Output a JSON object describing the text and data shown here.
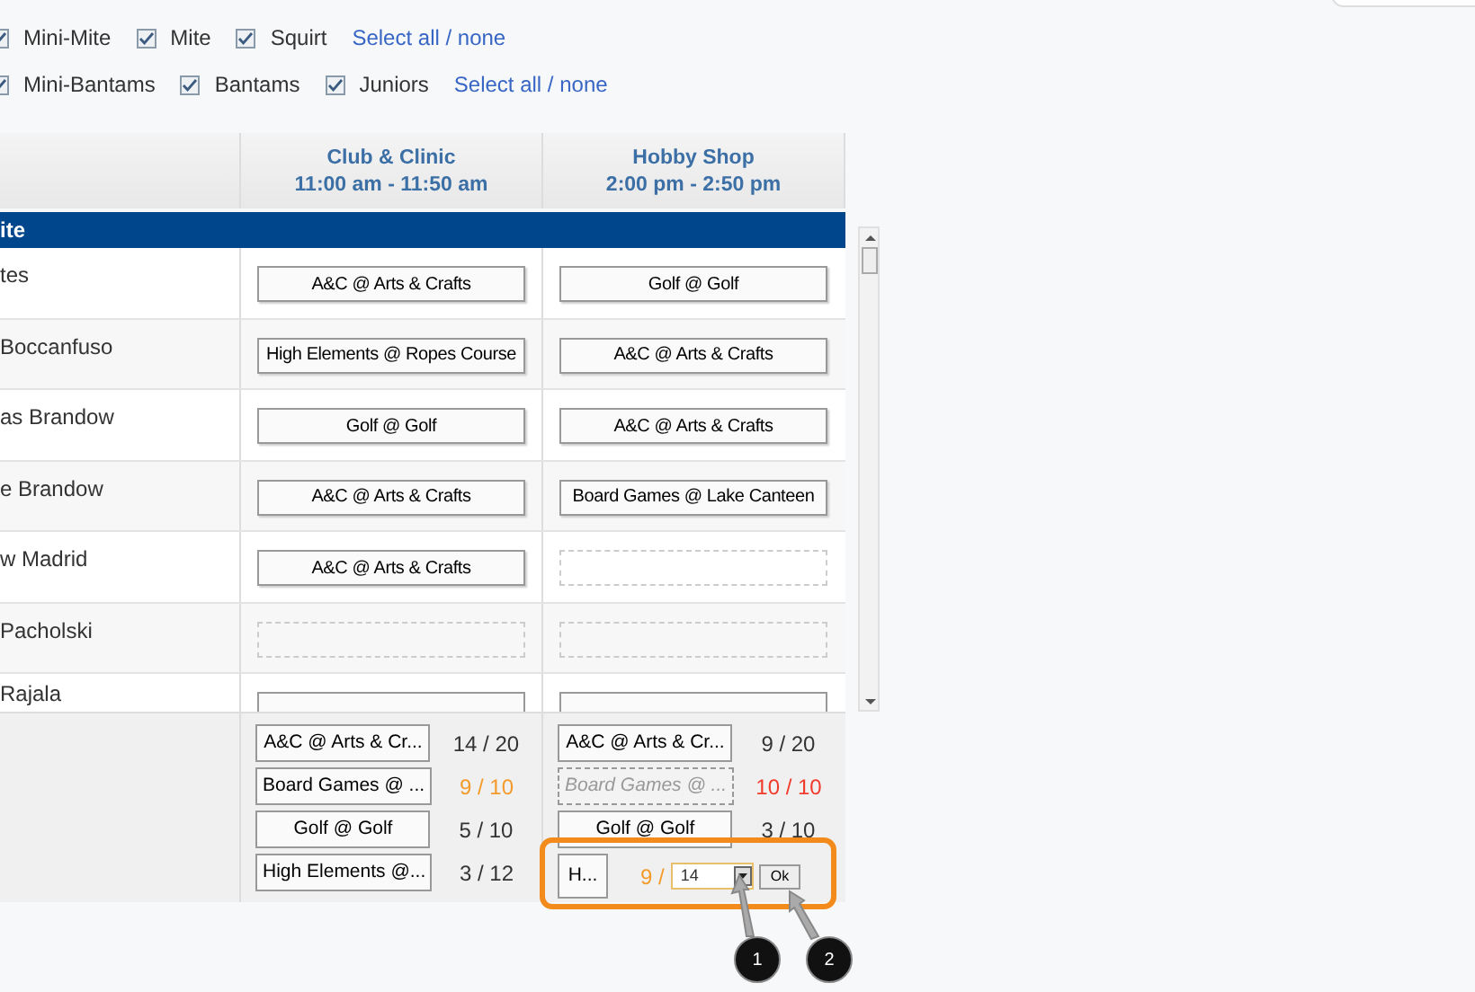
{
  "filters": [
    {
      "items": [
        {
          "label": "Mini-Mite",
          "checked": true
        },
        {
          "label": "Mite",
          "checked": true
        },
        {
          "label": "Squirt",
          "checked": true
        }
      ],
      "link": "Select all / none"
    },
    {
      "items": [
        {
          "label": "Mini-Bantams",
          "checked": true
        },
        {
          "label": "Bantams",
          "checked": true
        },
        {
          "label": "Juniors",
          "checked": true
        }
      ],
      "link": "Select all / none"
    }
  ],
  "columns": [
    {
      "title": "Club & Clinic",
      "time": "11:00 am - 11:50 am"
    },
    {
      "title": "Hobby Shop",
      "time": "2:00 pm - 2:50 pm"
    }
  ],
  "group": "ite",
  "rows": [
    {
      "name": "tes",
      "slots": [
        {
          "kind": "assigned",
          "text": "A&C @ Arts & Crafts"
        },
        {
          "kind": "assigned",
          "text": "Golf @ Golf"
        }
      ]
    },
    {
      "name": "Boccanfuso",
      "slots": [
        {
          "kind": "assigned",
          "text": "High Elements @ Ropes Course"
        },
        {
          "kind": "assigned",
          "text": "A&C @ Arts & Crafts"
        }
      ]
    },
    {
      "name": "as Brandow",
      "slots": [
        {
          "kind": "assigned",
          "text": "Golf @ Golf"
        },
        {
          "kind": "assigned",
          "text": "A&C @ Arts & Crafts"
        }
      ]
    },
    {
      "name": "e Brandow",
      "slots": [
        {
          "kind": "assigned",
          "text": "A&C @ Arts & Crafts"
        },
        {
          "kind": "assigned",
          "text": "Board Games @ Lake Canteen"
        }
      ]
    },
    {
      "name": "w Madrid",
      "slots": [
        {
          "kind": "assigned",
          "text": "A&C @ Arts & Crafts"
        },
        {
          "kind": "empty"
        }
      ]
    },
    {
      "name": "Pacholski",
      "slots": [
        {
          "kind": "empty"
        },
        {
          "kind": "empty"
        }
      ]
    },
    {
      "name": "Rajala",
      "slots": [
        {
          "kind": "clipped"
        },
        {
          "kind": "clipped"
        }
      ]
    }
  ],
  "summary": [
    [
      {
        "kind": "button",
        "label": "A&C @ Arts & Cr...",
        "count": "14 / 20",
        "color": "#333333"
      },
      {
        "kind": "button",
        "label": "Board Games @ ...",
        "count": "9 / 10",
        "color": "#f39a2b"
      },
      {
        "kind": "button",
        "label": "Golf @ Golf",
        "count": "5 / 10",
        "color": "#333333"
      },
      {
        "kind": "button",
        "label": "High Elements @...",
        "count": "3 / 12",
        "color": "#333333"
      }
    ],
    [
      {
        "kind": "button",
        "label": "A&C @ Arts & Cr...",
        "count": "9 / 20",
        "color": "#333333"
      },
      {
        "kind": "disabled",
        "label": "Board Games @ ...",
        "count": "10 / 10",
        "color": "#f03a2a"
      },
      {
        "kind": "button",
        "label": "Golf @ Golf",
        "count": "3 / 10",
        "color": "#333333"
      },
      {
        "kind": "edit",
        "label": "H...",
        "count": "9 /",
        "color": "#f39a2b",
        "value": "14",
        "ok": "Ok"
      }
    ]
  ],
  "callouts": [
    "1",
    "2"
  ]
}
